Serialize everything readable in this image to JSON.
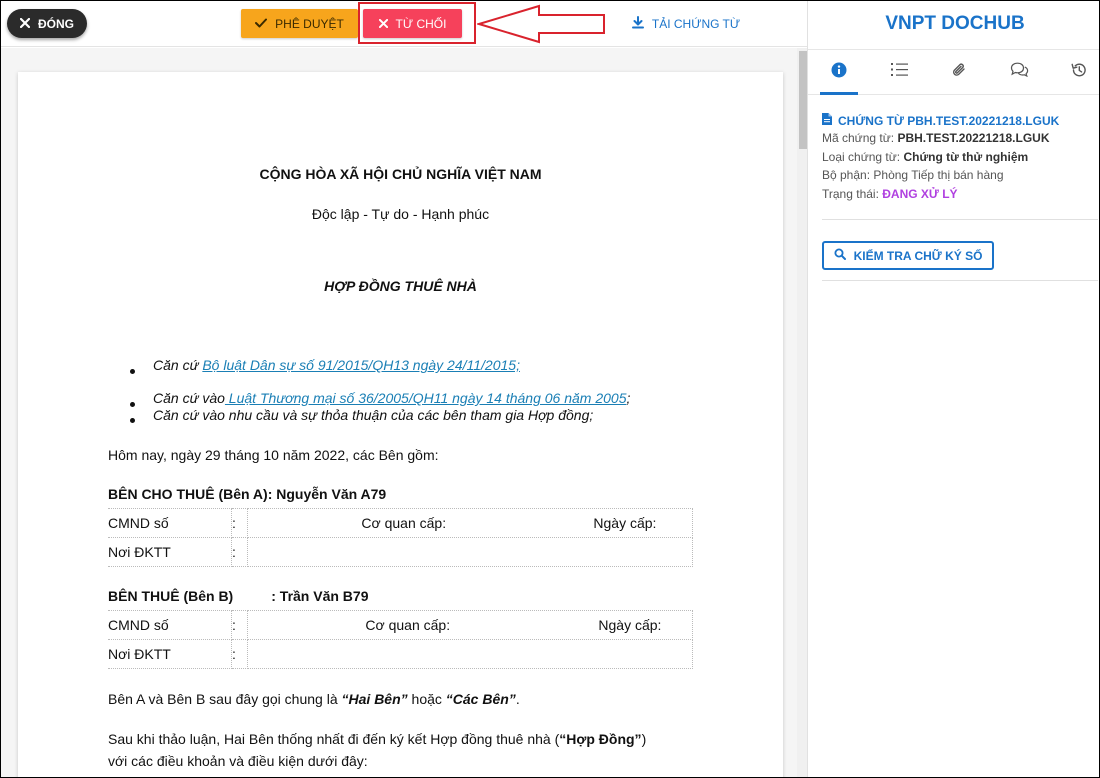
{
  "toolbar": {
    "close_label": "ĐÓNG",
    "approve_label": "PHÊ DUYỆT",
    "reject_label": "TỪ CHỐI",
    "download_label": "TẢI CHỨNG TỪ"
  },
  "panel": {
    "brand": "VNPT DOCHUB",
    "tabs": [
      {
        "icon": "info-icon"
      },
      {
        "icon": "list-icon"
      },
      {
        "icon": "paperclip-icon"
      },
      {
        "icon": "comments-icon"
      },
      {
        "icon": "history-icon"
      }
    ],
    "doc_title": "CHỨNG TỪ PBH.TEST.20221218.LGUK",
    "code_label": "Mã chứng từ:",
    "code_value": "PBH.TEST.20221218.LGUK",
    "type_label": "Loại chứng từ:",
    "type_value": "Chứng từ thử nghiệm",
    "dept_label": "Bộ phận:",
    "dept_value": "Phòng Tiếp thị bán hàng",
    "status_label": "Trạng thái:",
    "status_value": "ĐANG XỬ LÝ",
    "verify_label": "KIỂM TRA CHỮ KÝ SỐ",
    "colors": {
      "accent": "#1a73c9",
      "status": "#b040e0",
      "approve": "#f7a51c",
      "reject": "#f6415b"
    }
  },
  "document": {
    "nation": "CỘNG HÒA XÃ HỘI CHỦ NGHĨA VIỆT NAM",
    "motto": "Độc lập - Tự do - Hạnh phúc",
    "title": "HỢP ĐỒNG THUÊ NHÀ",
    "basis": [
      {
        "prefix": "Căn cứ ",
        "link": "Bộ luật Dân sự số 91/2015/QH13 ngày 24/11/2015;",
        "suffix": ""
      },
      {
        "prefix": "Căn cứ vào",
        "link": " Luật Thương mại số 36/2005/QH11 ngày 14 tháng 06 năm 2005",
        "suffix": ";"
      },
      {
        "prefix": "Căn cứ vào nhu cầu và sự thỏa thuận của các bên tham gia Hợp đồng;",
        "link": "",
        "suffix": ""
      }
    ],
    "today": "Hôm nay, ngày 29 tháng 10 năm 2022, các Bên gồm:",
    "party_a": {
      "heading": "BÊN CHO THUÊ (Bên A): Nguyễn Văn A79",
      "id_label": "CMND số",
      "colon": ":",
      "issuer_label": "Cơ quan cấp:",
      "date_label": "Ngày cấp:",
      "reg_label": "Nơi ĐKTT"
    },
    "party_b": {
      "heading_label": "BÊN THUÊ (Bên B)",
      "heading_name": ": Trần Văn B79",
      "id_label": "CMND số",
      "colon": ":",
      "issuer_label": "Cơ quan cấp:",
      "date_label": "Ngày cấp:",
      "reg_label": "Nơi ĐKTT"
    },
    "collective": {
      "pre": "Bên A và Bên B sau đây gọi chung là ",
      "term1": "“Hai Bên”",
      "mid": " hoặc ",
      "term2": "“Các Bên”",
      "post": "."
    },
    "agreement": {
      "pre": "Sau khi thảo luận, Hai Bên thống nhất đi đến ký kết Hợp đồng thuê nhà (",
      "term": "“Hợp Đồng”",
      "post": ")",
      "line2": "với các điều khoản và điều kiện dưới đây:"
    }
  }
}
